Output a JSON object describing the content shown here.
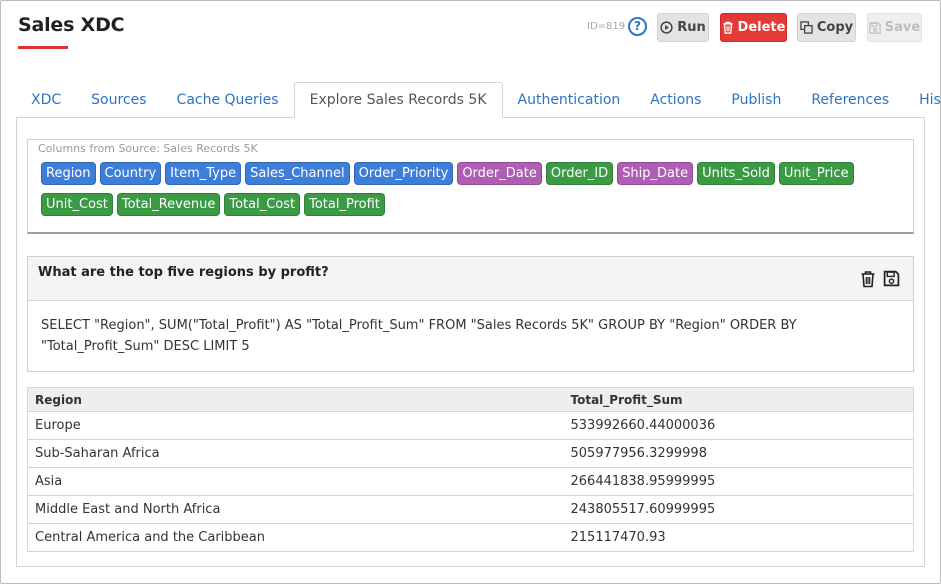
{
  "header": {
    "title": "Sales XDC",
    "id_text": "ID=819",
    "help": "?",
    "run_label": "Run",
    "delete_label": "Delete",
    "copy_label": "Copy",
    "save_label": "Save"
  },
  "tabs": [
    {
      "label": "XDC"
    },
    {
      "label": "Sources"
    },
    {
      "label": "Cache Queries"
    },
    {
      "label": "Explore Sales Records 5K",
      "active": true
    },
    {
      "label": "Authentication"
    },
    {
      "label": "Actions"
    },
    {
      "label": "Publish"
    },
    {
      "label": "References"
    },
    {
      "label": "History"
    }
  ],
  "columns": {
    "label": "Columns from Source: Sales Records 5K",
    "items": [
      {
        "name": "Region",
        "color": "#3d7fd8"
      },
      {
        "name": "Country",
        "color": "#3d7fd8"
      },
      {
        "name": "Item_Type",
        "color": "#3d7fd8"
      },
      {
        "name": "Sales_Channel",
        "color": "#3d7fd8"
      },
      {
        "name": "Order_Priority",
        "color": "#3d7fd8"
      },
      {
        "name": "Order_Date",
        "color": "#b05db4"
      },
      {
        "name": "Order_ID",
        "color": "#3b9b45"
      },
      {
        "name": "Ship_Date",
        "color": "#b05db4"
      },
      {
        "name": "Units_Sold",
        "color": "#3b9b45"
      },
      {
        "name": "Unit_Price",
        "color": "#3b9b45"
      },
      {
        "name": "Unit_Cost",
        "color": "#3b9b45"
      },
      {
        "name": "Total_Revenue",
        "color": "#3b9b45"
      },
      {
        "name": "Total_Cost",
        "color": "#3b9b45"
      },
      {
        "name": "Total_Profit",
        "color": "#3b9b45"
      }
    ]
  },
  "query": {
    "title": "What are the top five regions by profit?",
    "sql": "SELECT \"Region\", SUM(\"Total_Profit\") AS \"Total_Profit_Sum\" FROM \"Sales Records 5K\" GROUP BY \"Region\" ORDER BY \"Total_Profit_Sum\" DESC LIMIT 5"
  },
  "results": {
    "headers": [
      "Region",
      "Total_Profit_Sum"
    ],
    "rows": [
      [
        "Europe",
        "533992660.44000036"
      ],
      [
        "Sub-Saharan Africa",
        "505977956.3299998"
      ],
      [
        "Asia",
        "266441838.95999995"
      ],
      [
        "Middle East and North Africa",
        "243805517.60999995"
      ],
      [
        "Central America and the Caribbean",
        "215117470.93"
      ]
    ]
  },
  "colors": {
    "accent": "#2d73c6",
    "danger": "#e53935",
    "string_column": "#3d7fd8",
    "date_column": "#b05db4",
    "number_column": "#3b9b45"
  }
}
